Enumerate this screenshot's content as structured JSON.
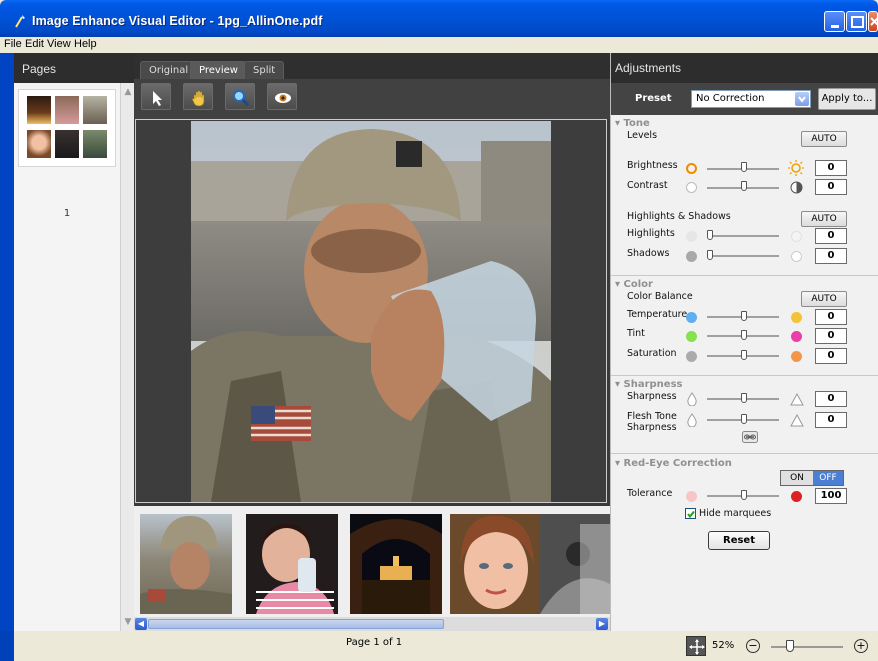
{
  "window": {
    "title": "Image Enhance Visual Editor - 1pg_AllinOne.pdf"
  },
  "menu": [
    "File",
    "Edit",
    "View",
    "Help"
  ],
  "pages_panel": {
    "title": "Pages",
    "page_number": "1"
  },
  "tabs": [
    {
      "label": "Original",
      "active": false
    },
    {
      "label": "Preview",
      "active": true
    },
    {
      "label": "Split",
      "active": false
    }
  ],
  "tools": [
    "pointer-icon",
    "hand-icon",
    "magnifier-icon",
    "eye-icon"
  ],
  "adjustments": {
    "title": "Adjustments",
    "preset": {
      "label": "Preset",
      "value": "No Correction",
      "apply": "Apply to..."
    },
    "tone": {
      "header": "Tone",
      "levels": "Levels",
      "auto": "AUTO",
      "brightness": {
        "label": "Brightness",
        "value": "0"
      },
      "contrast": {
        "label": "Contrast",
        "value": "0"
      },
      "hs_label": "Highlights & Shadows",
      "hs_auto": "AUTO",
      "highlights": {
        "label": "Highlights",
        "value": "0"
      },
      "shadows": {
        "label": "Shadows",
        "value": "0"
      }
    },
    "color": {
      "header": "Color",
      "balance": "Color Balance",
      "auto": "AUTO",
      "temperature": {
        "label": "Temperature",
        "value": "0"
      },
      "tint": {
        "label": "Tint",
        "value": "0"
      },
      "saturation": {
        "label": "Saturation",
        "value": "0"
      }
    },
    "sharpness": {
      "header": "Sharpness",
      "sharpness": {
        "label": "Sharpness",
        "value": "0"
      },
      "flesh_line1": "Flesh Tone",
      "flesh_line2": "Sharpness",
      "flesh": {
        "value": "0"
      }
    },
    "redeye": {
      "header": "Red-Eye Correction",
      "on": "ON",
      "off": "OFF",
      "tolerance": {
        "label": "Tolerance",
        "value": "100"
      },
      "hide_marquees": "Hide marquees",
      "hide_checked": true
    },
    "reset": "Reset"
  },
  "status": {
    "page_text": "Page 1 of 1",
    "zoom": "52%"
  },
  "colors": {
    "accent": "#0054e3",
    "panel_dark": "#2d2d2d",
    "toggle_off": "#4a7fd4"
  }
}
